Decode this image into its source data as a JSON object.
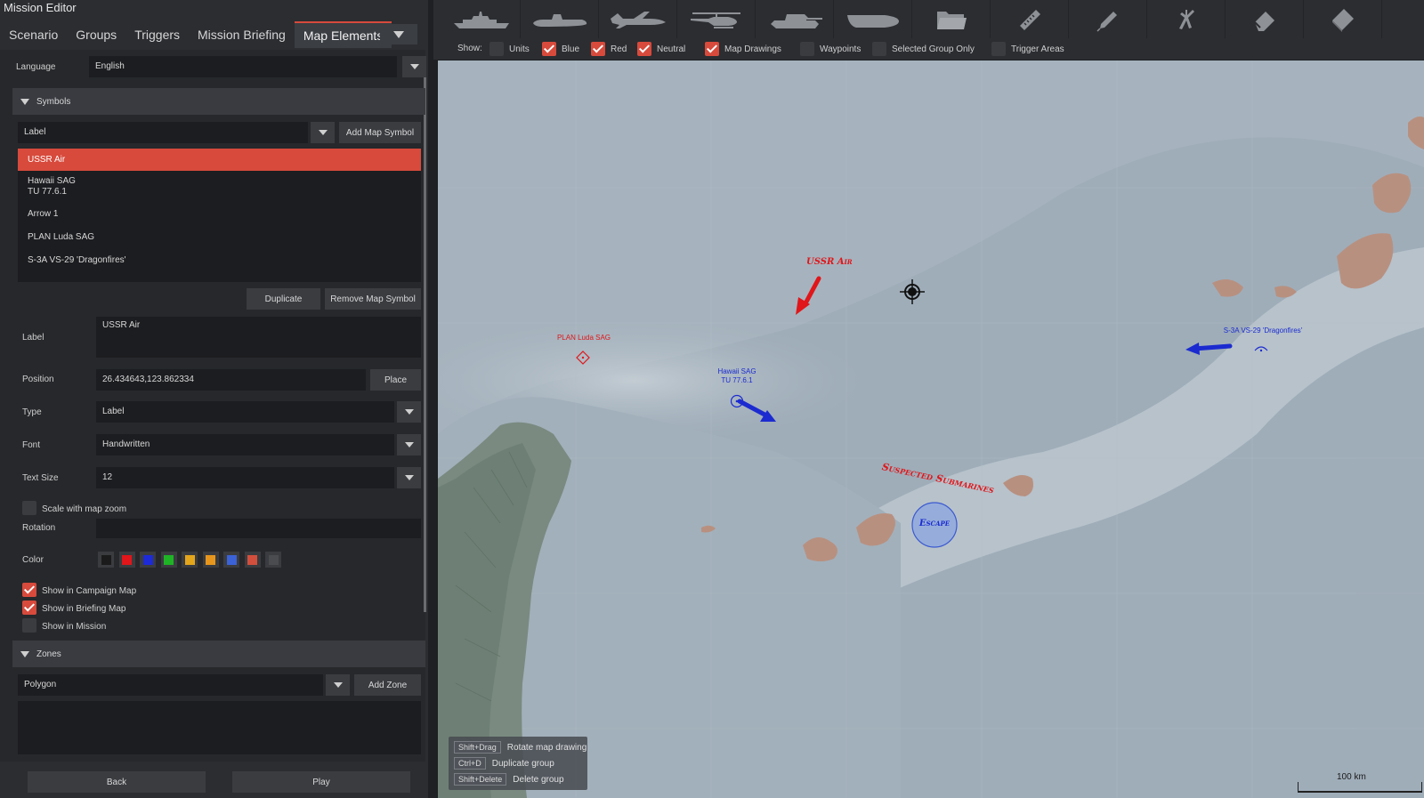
{
  "window": {
    "title": "Mission Editor"
  },
  "tabs": [
    {
      "label": "Scenario",
      "active": false
    },
    {
      "label": "Groups",
      "active": false
    },
    {
      "label": "Triggers",
      "active": false
    },
    {
      "label": "Mission Briefing",
      "active": false
    },
    {
      "label": "Map Elements",
      "active": true
    }
  ],
  "language": {
    "label": "Language",
    "value": "English"
  },
  "symbols": {
    "header": "Symbols",
    "type_value": "Label",
    "add_button": "Add Map Symbol",
    "items": [
      {
        "label": "USSR Air",
        "selected": true
      },
      {
        "label": "Hawaii SAG\nTU 77.6.1",
        "selected": false
      },
      {
        "label": "Arrow 1",
        "selected": false
      },
      {
        "label": "PLAN Luda SAG",
        "selected": false
      },
      {
        "label": "S-3A VS-29 'Dragonfires'",
        "selected": false
      }
    ],
    "duplicate_button": "Duplicate",
    "remove_button": "Remove Map Symbol"
  },
  "properties": {
    "label": {
      "label": "Label",
      "value": "USSR Air"
    },
    "position": {
      "label": "Position",
      "value": "26.434643,123.862334",
      "place_button": "Place"
    },
    "type": {
      "label": "Type",
      "value": "Label"
    },
    "font": {
      "label": "Font",
      "value": "Handwritten"
    },
    "text_size": {
      "label": "Text Size",
      "value": "12"
    },
    "scale_with_zoom": {
      "label": "Scale with map zoom",
      "checked": false
    },
    "rotation": {
      "label": "Rotation",
      "value": ""
    },
    "color": {
      "label": "Color",
      "swatches": [
        "#1b1b1b",
        "#e0161a",
        "#1d2ad8",
        "#1fb326",
        "#e3a51b",
        "#e6961c",
        "#3b62d6",
        "#d24f3d",
        "#4a4c50"
      ]
    },
    "show_campaign": {
      "label": "Show in Campaign Map",
      "checked": true
    },
    "show_briefing": {
      "label": "Show in Briefing Map",
      "checked": true
    },
    "show_mission": {
      "label": "Show in Mission",
      "checked": false
    }
  },
  "zones": {
    "header": "Zones",
    "type_value": "Polygon",
    "add_button": "Add Zone"
  },
  "footer": {
    "back": "Back",
    "play": "Play"
  },
  "toolbar": {
    "tools": [
      "ship-icon",
      "submarine-icon",
      "airplane-icon",
      "helicopter-icon",
      "tank-icon",
      "bomb-icon",
      "folder-icon",
      "ruler-icon",
      "pencil-icon",
      "compass-icon",
      "eraser-icon",
      "clear-icon"
    ]
  },
  "show_bar": {
    "label": "Show:",
    "items": [
      {
        "label": "Units",
        "checked": false
      },
      {
        "label": "Blue",
        "checked": true
      },
      {
        "label": "Red",
        "checked": true
      },
      {
        "label": "Neutral",
        "checked": true
      },
      {
        "label": "Map Drawings",
        "checked": true
      },
      {
        "label": "Waypoints",
        "checked": false
      },
      {
        "label": "Selected Group Only",
        "checked": false
      },
      {
        "label": "Trigger Areas",
        "checked": false
      }
    ]
  },
  "map": {
    "labels": {
      "ussr_air": "USSR Air",
      "plan_luda": "PLAN Luda SAG",
      "hawaii_sag": "Hawaii SAG\nTU 77.6.1",
      "s3a": "S-3A VS-29 'Dragonfires'",
      "submarines": "Suspected Submarines",
      "escape": "Escape"
    },
    "colors": {
      "red": "#e0161a",
      "blue": "#1b2bd0",
      "sea": "#a9b6c1"
    },
    "scale": "100 km",
    "shortcuts": [
      {
        "key": "Shift+Drag",
        "desc": "Rotate map drawing"
      },
      {
        "key": "Ctrl+D",
        "desc": "Duplicate group"
      },
      {
        "key": "Shift+Delete",
        "desc": "Delete group"
      }
    ]
  }
}
